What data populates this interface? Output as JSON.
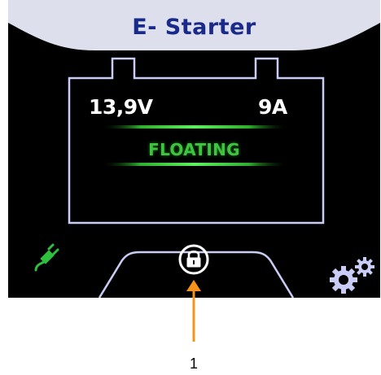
{
  "header": {
    "title": "E- Starter"
  },
  "battery_display": {
    "voltage": "13,9V",
    "current": "9A",
    "status": "FLOATING",
    "status_color": "#3fc43f"
  },
  "footer": {
    "plug_icon": "plug-icon",
    "lock_icon": "padlock-icon",
    "settings_icon": "gears-icon"
  },
  "annotation": {
    "label": "1",
    "arrow_color": "#f5941d"
  },
  "colors": {
    "title_panel": "#dde0ec",
    "title_text": "#1a2a8a",
    "outline": "#c9ccf4",
    "background": "#000000"
  }
}
